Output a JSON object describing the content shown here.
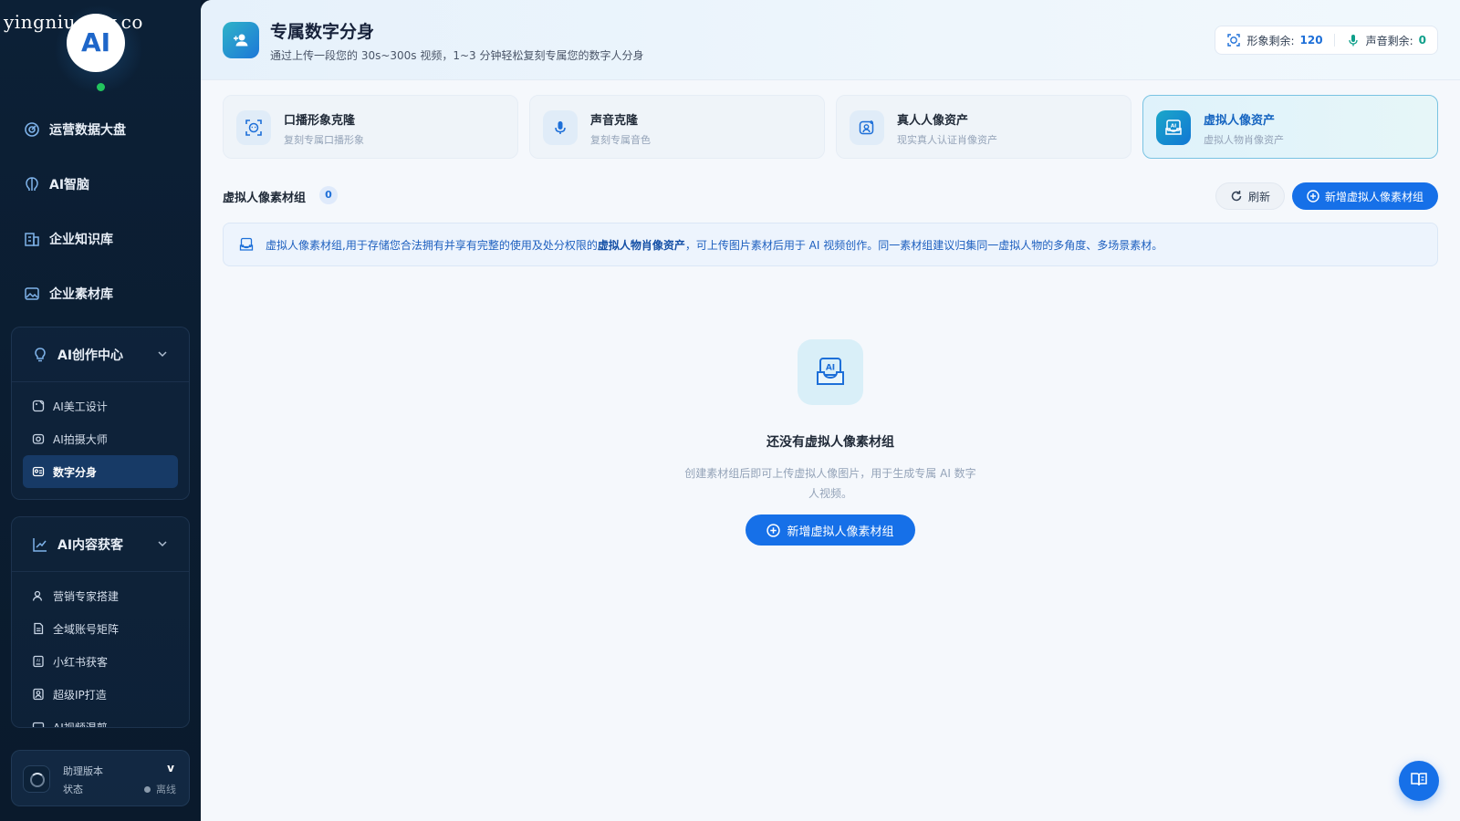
{
  "watermark": "yingniu.10v.co",
  "logo": {
    "text": "AI",
    "status_color": "#22c55e"
  },
  "sidebar": {
    "top_items": [
      {
        "label": "运营数据大盘",
        "icon": "dashboard-icon"
      },
      {
        "label": "AI智脑",
        "icon": "brain-icon"
      },
      {
        "label": "企业知识库",
        "icon": "knowledge-base-icon"
      },
      {
        "label": "企业素材库",
        "icon": "image-library-icon"
      }
    ],
    "group1": {
      "label": "AI创作中心",
      "icon": "bulb-icon",
      "items": [
        {
          "label": "AI美工设计",
          "icon": "palette-icon"
        },
        {
          "label": "AI拍摄大师",
          "icon": "camera-icon"
        },
        {
          "label": "数字分身",
          "icon": "avatar-card-icon",
          "active": true
        }
      ]
    },
    "group2": {
      "label": "AI内容获客",
      "icon": "trend-chart-icon",
      "items": [
        {
          "label": "营销专家搭建",
          "icon": "user-expert-icon"
        },
        {
          "label": "全域账号矩阵",
          "icon": "document-icon"
        },
        {
          "label": "小红书获客",
          "icon": "ai-doc-icon"
        },
        {
          "label": "超级IP打造",
          "icon": "id-badge-icon"
        },
        {
          "label": "AI视频混剪",
          "icon": "video-icon"
        }
      ]
    },
    "assistant": {
      "label": "助理版本",
      "version": "v",
      "status_label": "状态",
      "status_value": "离线"
    }
  },
  "header": {
    "title": "专属数字分身",
    "subtitle": "通过上传一段您的 30s~300s 视频，1~3 分钟轻松复刻专属您的数字人分身",
    "quota": {
      "image_label": "形象剩余:",
      "image_value": "120",
      "voice_label": "声音剩余:",
      "voice_value": "0"
    }
  },
  "tabs": [
    {
      "title": "口播形象克隆",
      "subtitle": "复刻专属口播形象",
      "icon": "face-scan-icon"
    },
    {
      "title": "声音克隆",
      "subtitle": "复刻专属音色",
      "icon": "microphone-icon"
    },
    {
      "title": "真人人像资产",
      "subtitle": "现实真人认证肖像资产",
      "icon": "portrait-add-icon"
    },
    {
      "title": "虚拟人像资产",
      "subtitle": "虚拟人物肖像资产",
      "icon": "ai-inbox-icon",
      "active": true
    }
  ],
  "section": {
    "title": "虚拟人像素材组",
    "count": "0",
    "refresh_label": "刷新",
    "add_label": "新增虚拟人像素材组"
  },
  "notice": {
    "text_before": "虚拟人像素材组,用于存储您合法拥有并享有完整的使用及处分权限的 ",
    "highlight": "虚拟人物肖像资产",
    "text_after": "，可上传图片素材后用于 AI 视频创作。同一素材组建议归集同一虚拟人物的多角度、多场景素材。"
  },
  "empty": {
    "title": "还没有虚拟人像素材组",
    "desc": "创建素材组后即可上传虚拟人像图片，用于生成专属 AI 数字人视频。",
    "button_label": "新增虚拟人像素材组"
  },
  "colors": {
    "primary": "#1670e8",
    "sidebar_bg": "#0c2036",
    "accent_teal": "#1aa7c9"
  }
}
